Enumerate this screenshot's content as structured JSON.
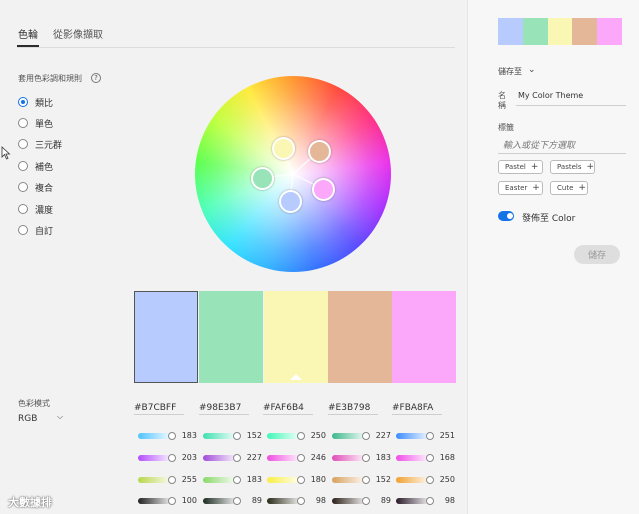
{
  "tabs": {
    "color_wheel": "色輪",
    "extract_from_image": "從影像擷取"
  },
  "rules": {
    "title": "套用色彩調和規則",
    "help": "?",
    "items": [
      {
        "label": "類比",
        "checked": true
      },
      {
        "label": "單色",
        "checked": false
      },
      {
        "label": "三元群",
        "checked": false
      },
      {
        "label": "補色",
        "checked": false
      },
      {
        "label": "複合",
        "checked": false
      },
      {
        "label": "濃度",
        "checked": false
      },
      {
        "label": "自訂",
        "checked": false
      }
    ]
  },
  "wheel_nodes": [
    {
      "color": "#FAF6B4",
      "name": "wheel-node-yellow"
    },
    {
      "color": "#E3B798",
      "name": "wheel-node-peach"
    },
    {
      "color": "#98E3B7",
      "name": "wheel-node-green"
    },
    {
      "color": "#FBA8FA",
      "name": "wheel-node-pink"
    },
    {
      "color": "#B7CBFF",
      "name": "wheel-node-blue"
    }
  ],
  "colors": [
    {
      "hex": "#B7CBFF",
      "values": [
        "183",
        "203",
        "255",
        "100"
      ],
      "slider_colors": [
        "#4fc3ff",
        "#b24cff",
        "#b7d64a",
        "#222222"
      ]
    },
    {
      "hex": "#98E3B7",
      "values": [
        "152",
        "227",
        "183",
        "89"
      ],
      "slider_colors": [
        "#3fe0b0",
        "#a04cd8",
        "#8ad868",
        "#1d2b22"
      ]
    },
    {
      "hex": "#FAF6B4",
      "values": [
        "250",
        "246",
        "180",
        "98"
      ],
      "slider_colors": [
        "#3ff8b8",
        "#f04ce0",
        "#f8ee40",
        "#2a2a18"
      ]
    },
    {
      "hex": "#E3B798",
      "values": [
        "227",
        "183",
        "152",
        "89"
      ],
      "slider_colors": [
        "#3cb88c",
        "#e04cb8",
        "#d8a05c",
        "#2b1f18"
      ]
    },
    {
      "hex": "#FBA8FA",
      "values": [
        "251",
        "168",
        "250",
        "98"
      ],
      "slider_colors": [
        "#3b8cff",
        "#f04ce8",
        "#f0a030",
        "#2a1a2a"
      ]
    }
  ],
  "color_mode": {
    "title": "色彩模式",
    "value": "RGB"
  },
  "right_panel": {
    "save_to": "儲存至",
    "name_label": "名稱",
    "name_value": "My Color Theme",
    "tag_label": "標籤",
    "tag_placeholder": "輸入或從下方選取",
    "tags": [
      "Pastel",
      "Pastels",
      "Easter",
      "Cute"
    ],
    "publish_label": "發佈至 Color",
    "publish_on": true,
    "save_button": "儲存"
  },
  "watermark": "大數據排"
}
